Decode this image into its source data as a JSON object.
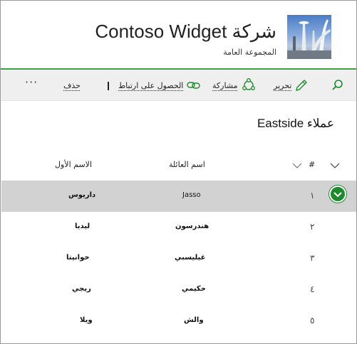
{
  "header": {
    "title": "شركة Contoso Widget",
    "subtitle": "المجموعة العامة",
    "logo_icon": "city-skyline-logo"
  },
  "toolbar": {
    "search_icon": "search-icon",
    "edit_label": "تحرير",
    "share_label": "مشاركة",
    "get_link_label": "الحصول على ارتباط",
    "delete_label": "حذف",
    "more_label": "···"
  },
  "list": {
    "title": "عملاء Eastside",
    "columns": {
      "number": "#",
      "last_name": "اسم العائلة",
      "first_name": "الاسم الأول"
    },
    "rows": [
      {
        "num": "١",
        "last": "Jasso",
        "first": "داريوس",
        "selected": true
      },
      {
        "num": "٢",
        "last": "هندرسون",
        "first": "ليديا",
        "selected": false
      },
      {
        "num": "٣",
        "last": "غيليسبي",
        "first": "خوانيتا",
        "selected": false
      },
      {
        "num": "٤",
        "last": "حكيمي",
        "first": "ريجي",
        "selected": false
      },
      {
        "num": "٥",
        "last": "والش",
        "first": "ويلا",
        "selected": false
      }
    ]
  },
  "colors": {
    "accent": "#3aa142",
    "selected_row": "#d2d2d2",
    "toolbar_bg": "#efefef",
    "check": "#1e8a2e"
  }
}
